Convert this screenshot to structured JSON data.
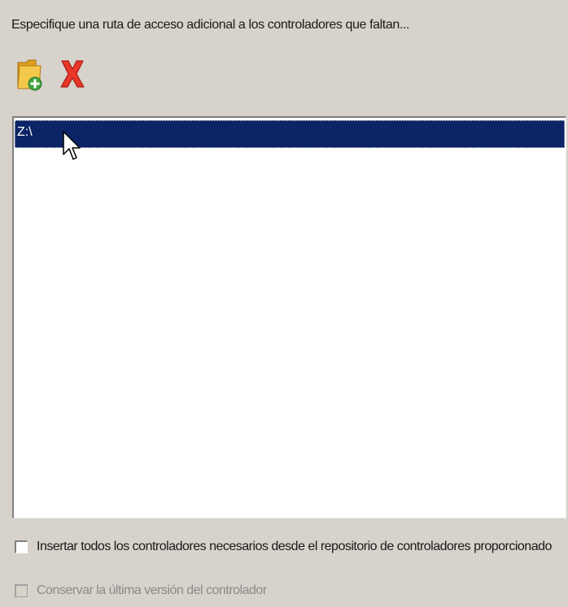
{
  "instruction": "Especifique una ruta de acceso adicional a los controladores que faltan...",
  "toolbar": {
    "add_icon": "folder-add-icon",
    "remove_icon": "delete-x-icon"
  },
  "paths_list": {
    "items": [
      {
        "label": "Z:\\",
        "selected": true
      }
    ]
  },
  "options": {
    "insert_all_drivers": {
      "label": "Insertar todos los controladores necesarios desde el repositorio de controladores proporcionado",
      "checked": false,
      "enabled": true
    },
    "keep_latest_version": {
      "label": "Conservar la última versión del controlador",
      "checked": false,
      "enabled": false
    }
  },
  "colors": {
    "selection": "#0b2466",
    "dialog_bg": "#d7d3cb"
  }
}
